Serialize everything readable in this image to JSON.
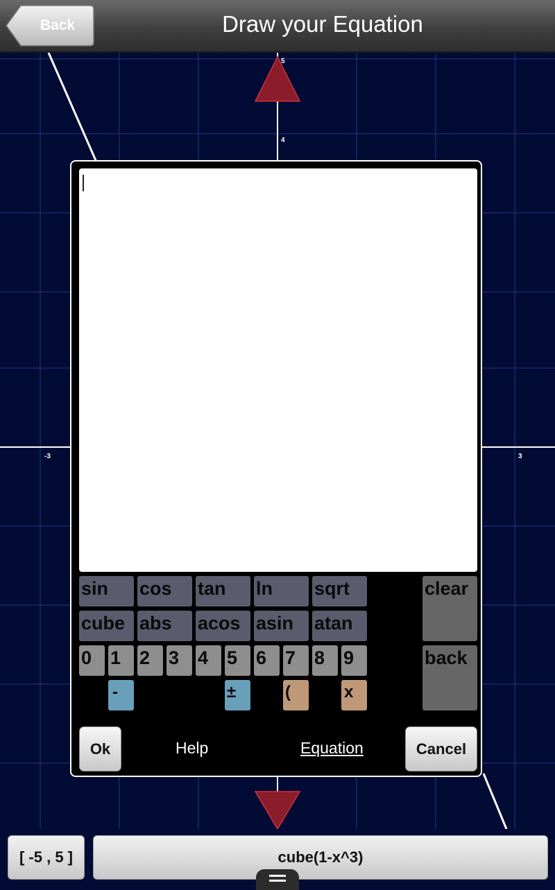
{
  "header": {
    "back_label": "Back",
    "title": "Draw your Equation"
  },
  "graph": {
    "tick_labels": {
      "y_top": "5",
      "y_upper": "4",
      "x_left": "-3",
      "x_right": "3"
    },
    "colors": {
      "background": "#020b33",
      "grid": "#1e3a8a",
      "axis": "#ffffff",
      "curve": "#ffffff",
      "arrow": "#8b1c2a"
    }
  },
  "dialog": {
    "keyboard": {
      "row1": [
        "sin",
        "cos",
        "tan",
        "ln",
        "sqrt"
      ],
      "row2": [
        "cube",
        "abs",
        "acos",
        "asin",
        "atan"
      ],
      "digits": [
        "0",
        "1",
        "2",
        "3",
        "4",
        "5",
        "6",
        "7",
        "8",
        "9"
      ],
      "operators": [
        "-",
        "±",
        "(",
        "x"
      ],
      "clear_label": "clear",
      "back_label": "back"
    },
    "ok_label": "Ok",
    "help_label": "Help",
    "equation_label": "Equation",
    "cancel_label": "Cancel"
  },
  "bottom_bar": {
    "range_label": "[ -5 , 5 ]",
    "equation_value": "cube(1-x^3)"
  }
}
